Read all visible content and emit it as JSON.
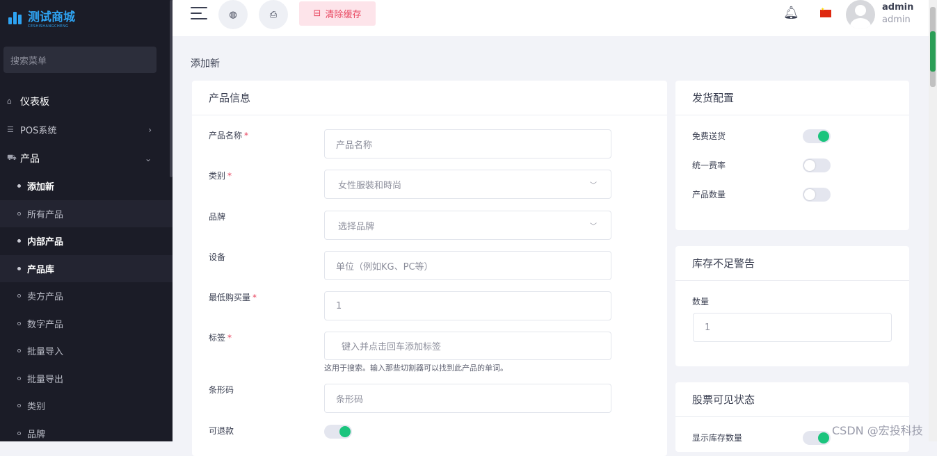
{
  "sidebar": {
    "logo": {
      "text": "测试商城",
      "sub": "CESHISHANGCHENG"
    },
    "search_placeholder": "搜索菜单",
    "menu": [
      {
        "label": "仪表板",
        "icon": "home-icon"
      },
      {
        "label": "POS系统",
        "icon": "list-icon"
      },
      {
        "label": "产品",
        "icon": "cart-icon"
      }
    ],
    "submenu": [
      {
        "label": "添加新",
        "state": "active"
      },
      {
        "label": "所有产品",
        "state": "normal"
      },
      {
        "label": "内部产品",
        "state": "bold"
      },
      {
        "label": "产品库",
        "state": "bold"
      },
      {
        "label": "卖方产品",
        "state": "normal"
      },
      {
        "label": "数字产品",
        "state": "normal"
      },
      {
        "label": "批量导入",
        "state": "normal"
      },
      {
        "label": "批量导出",
        "state": "normal"
      },
      {
        "label": "类别",
        "state": "normal"
      },
      {
        "label": "品牌",
        "state": "normal"
      }
    ]
  },
  "topbar": {
    "clear_cache": "清除缓存",
    "user_name": "admin",
    "user_role": "admin"
  },
  "page": {
    "title": "添加新"
  },
  "product_info": {
    "title": "产品信息",
    "fields": [
      {
        "label": "产品名称",
        "required": "*",
        "placeholder": "产品名称"
      },
      {
        "label": "类别",
        "required": "*",
        "value": "女性服裝和時尚"
      },
      {
        "label": "品牌",
        "required": "",
        "value": "选择品牌"
      },
      {
        "label": "设备",
        "required": "",
        "placeholder": "单位（例如KG、PC等）"
      },
      {
        "label": "最低购买量",
        "required": "*",
        "value": "1"
      },
      {
        "label": "标签",
        "required": "*",
        "placeholder": "键入并点击回车添加标签",
        "hint": "这用于搜索。输入那些切割器可以找到此产品的单词。"
      },
      {
        "label": "条形码",
        "required": "",
        "placeholder": "条形码"
      },
      {
        "label": "可退款",
        "required": "",
        "toggle": "on"
      }
    ]
  },
  "shipping": {
    "title": "发货配置",
    "rows": [
      {
        "label": "免费送货",
        "toggle": "on"
      },
      {
        "label": "统一费率",
        "toggle": "off"
      },
      {
        "label": "产品数量",
        "toggle": "off"
      }
    ]
  },
  "low_stock": {
    "title": "库存不足警告",
    "label": "数量",
    "value": "1"
  },
  "stock_visibility": {
    "title": "股票可见状态",
    "row_label": "显示库存数量",
    "toggle": "on"
  },
  "watermark": "CSDN @宏投科技",
  "colors": {
    "accent_green": "#1bc47d",
    "danger": "#e8455f",
    "sidebar_bg": "#1b1c27"
  }
}
